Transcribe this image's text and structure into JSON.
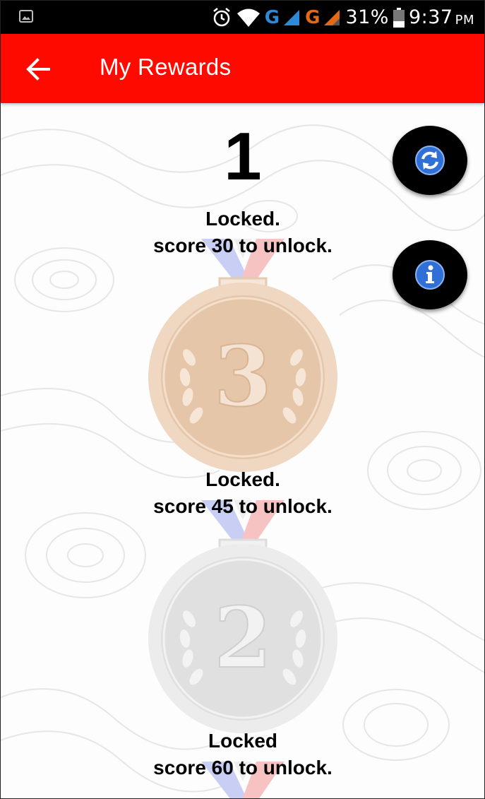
{
  "status_bar": {
    "network_1": "G",
    "network_2": "G",
    "battery": "31%",
    "time": "9:37",
    "ampm": "PM"
  },
  "app_bar": {
    "title": "My Rewards"
  },
  "score": "1",
  "rewards": [
    {
      "medal": "3",
      "line1": "Locked.",
      "line2": "score 30 to unlock."
    },
    {
      "medal": "2",
      "line1": "Locked.",
      "line2": "score 45 to unlock."
    },
    {
      "medal": "1",
      "line1": "Locked",
      "line2": "score 60 to unlock."
    }
  ],
  "colors": {
    "app_bar": "#ff0a00",
    "bronze": "#e9c9ad",
    "silver": "#e2e2e2",
    "fab": "#000000",
    "fab_icon": "#2f6fd6"
  }
}
